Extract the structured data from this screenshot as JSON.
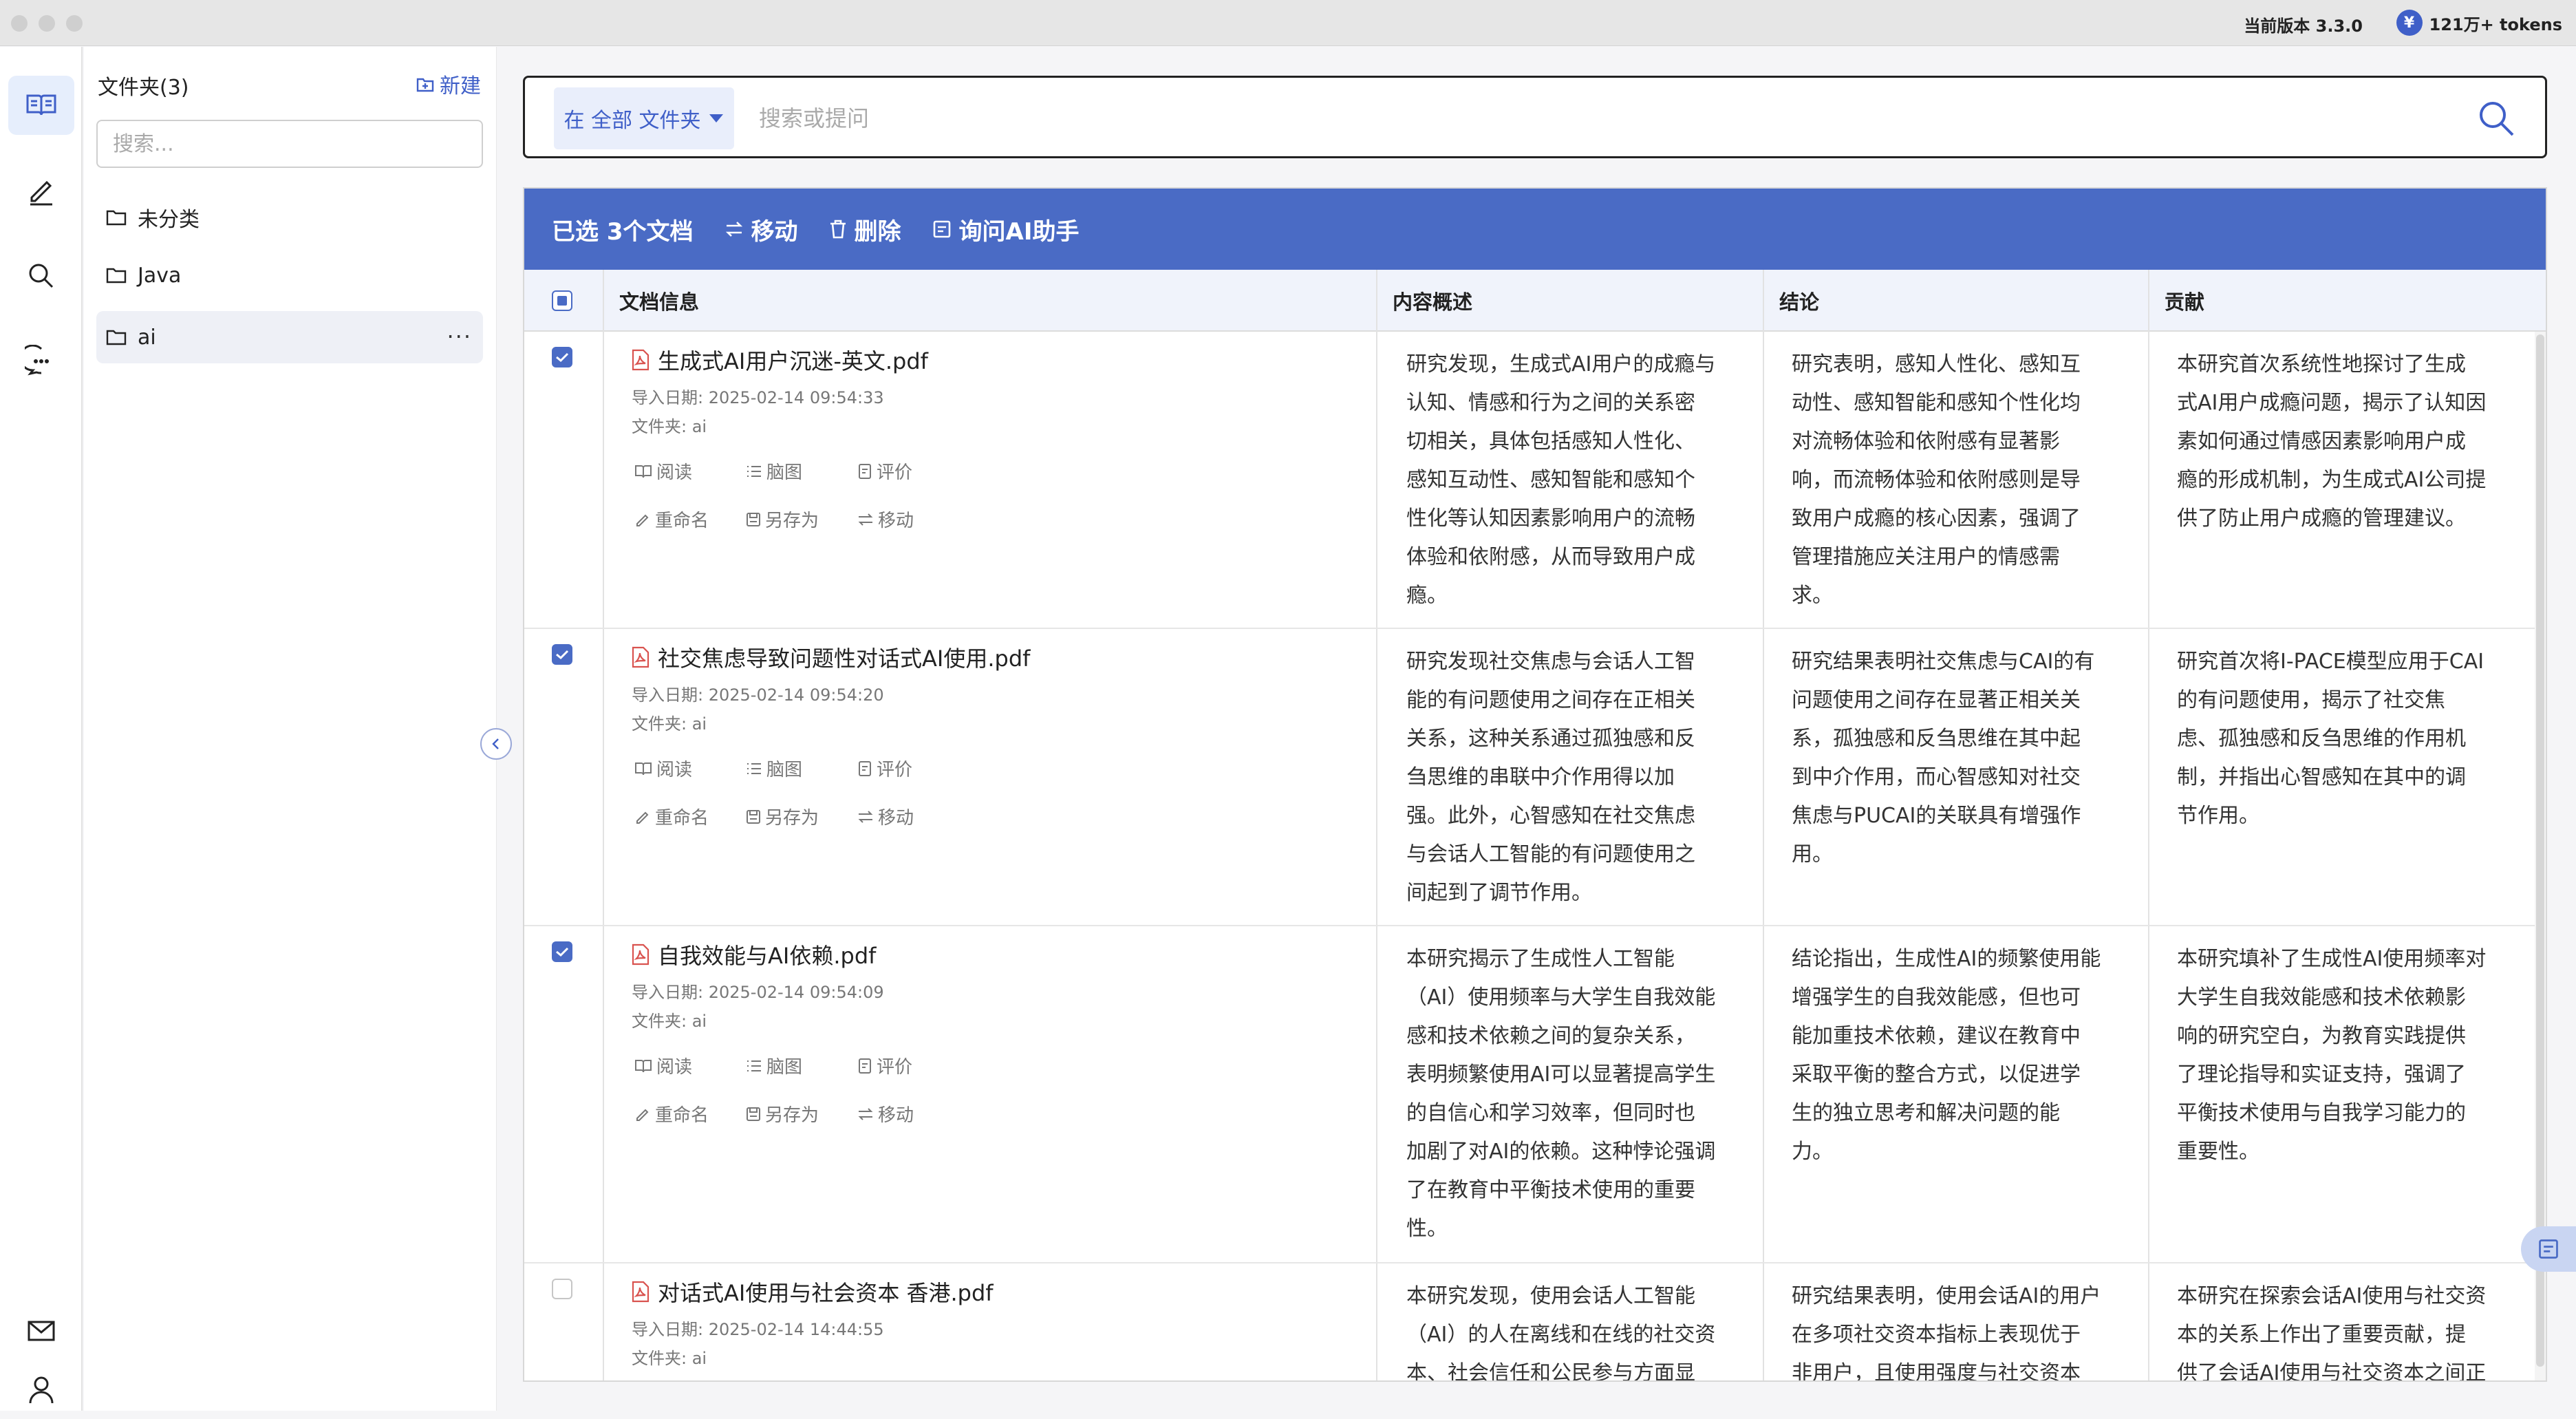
{
  "titlebar": {
    "version": "当前版本 3.3.0",
    "tokens": "121万+ tokens",
    "yen": "¥"
  },
  "folders": {
    "title": "文件夹(3)",
    "new_label": "新建",
    "search_placeholder": "搜索...",
    "items": [
      {
        "label": "未分类"
      },
      {
        "label": "Java"
      },
      {
        "label": "ai"
      }
    ],
    "more": "···"
  },
  "search": {
    "scope_label": "在 全部 文件夹",
    "placeholder": "搜索或提问"
  },
  "actionbar": {
    "selected": "已选 3个文档",
    "move": "移动",
    "delete": "删除",
    "ask": "询问AI助手"
  },
  "table": {
    "headers": {
      "doc": "文档信息",
      "summary": "内容概述",
      "conclusion": "结论",
      "contribution": "贡献"
    },
    "actions": {
      "read": "阅读",
      "mindmap": "脑图",
      "review": "评价",
      "rename": "重命名",
      "saveas": "另存为",
      "move": "移动"
    },
    "rows": [
      {
        "checked": true,
        "name": "生成式AI用户沉迷-英文.pdf",
        "date": "导入日期: 2025-02-14 09:54:33",
        "folder": "文件夹: ai",
        "summary": [
          "研究发现，生成式AI用户的成瘾与",
          "认知、情感和行为之间的关系密",
          "切相关，具体包括感知人性化、",
          "感知互动性、感知智能和感知个",
          "性化等认知因素影响用户的流畅",
          "体验和依附感，从而导致用户成",
          "瘾。"
        ],
        "conclusion": [
          "研究表明，感知人性化、感知互",
          "动性、感知智能和感知个性化均",
          "对流畅体验和依附感有显著影",
          "响，而流畅体验和依附感则是导",
          "致用户成瘾的核心因素，强调了",
          "管理措施应关注用户的情感需",
          "求。"
        ],
        "contribution": [
          "本研究首次系统性地探讨了生成",
          "式AI用户成瘾问题，揭示了认知因",
          "素如何通过情感因素影响用户成",
          "瘾的形成机制，为生成式AI公司提",
          "供了防止用户成瘾的管理建议。"
        ]
      },
      {
        "checked": true,
        "name": "社交焦虑导致问题性对话式AI使用.pdf",
        "date": "导入日期: 2025-02-14 09:54:20",
        "folder": "文件夹: ai",
        "summary": [
          "研究发现社交焦虑与会话人工智",
          "能的有问题使用之间存在正相关",
          "关系，这种关系通过孤独感和反",
          "刍思维的串联中介作用得以加",
          "强。此外，心智感知在社交焦虑",
          "与会话人工智能的有问题使用之",
          "间起到了调节作用。"
        ],
        "conclusion": [
          "研究结果表明社交焦虑与CAI的有",
          "问题使用之间存在显著正相关关",
          "系，孤独感和反刍思维在其中起",
          "到中介作用，而心智感知对社交",
          "焦虑与PUCAI的关联具有增强作",
          "用。"
        ],
        "contribution": [
          "研究首次将I-PACE模型应用于CAI",
          "的有问题使用，揭示了社交焦",
          "虑、孤独感和反刍思维的作用机",
          "制，并指出心智感知在其中的调",
          "节作用。"
        ]
      },
      {
        "checked": true,
        "name": "自我效能与AI依赖.pdf",
        "date": "导入日期: 2025-02-14 09:54:09",
        "folder": "文件夹: ai",
        "summary": [
          "本研究揭示了生成性人工智能",
          "（AI）使用频率与大学生自我效能",
          "感和技术依赖之间的复杂关系，",
          "表明频繁使用AI可以显著提高学生",
          "的自信心和学习效率，但同时也",
          "加剧了对AI的依赖。这种悖论强调",
          "了在教育中平衡技术使用的重要",
          "性。"
        ],
        "conclusion": [
          "结论指出，生成性AI的频繁使用能",
          "增强学生的自我效能感，但也可",
          "能加重技术依赖，建议在教育中",
          "采取平衡的整合方式，以促进学",
          "生的独立思考和解决问题的能",
          "力。"
        ],
        "contribution": [
          "本研究填补了生成性AI使用频率对",
          "大学生自我效能感和技术依赖影",
          "响的研究空白，为教育实践提供",
          "了理论指导和实证支持，强调了",
          "平衡技术使用与自我学习能力的",
          "重要性。"
        ]
      },
      {
        "checked": false,
        "name": "对话式AI使用与社会资本 香港.pdf",
        "date": "导入日期: 2025-02-14 14:44:55",
        "folder": "文件夹: ai",
        "summary": [
          "本研究发现，使用会话人工智能",
          "（AI）的人在离线和在线的社交资",
          "本、社会信任和公民参与方面显"
        ],
        "conclusion": [
          "研究结果表明，使用会话AI的用户",
          "在多项社交资本指标上表现优于",
          "非用户，且使用强度与社交资本"
        ],
        "contribution": [
          "本研究在探索会话AI使用与社交资",
          "本的关系上作出了重要贡献，提",
          "供了会话AI使用与社交资本之间正"
        ]
      }
    ]
  },
  "colors": {
    "accent": "#4a6bc5",
    "pdf_red": "#d9534f"
  }
}
